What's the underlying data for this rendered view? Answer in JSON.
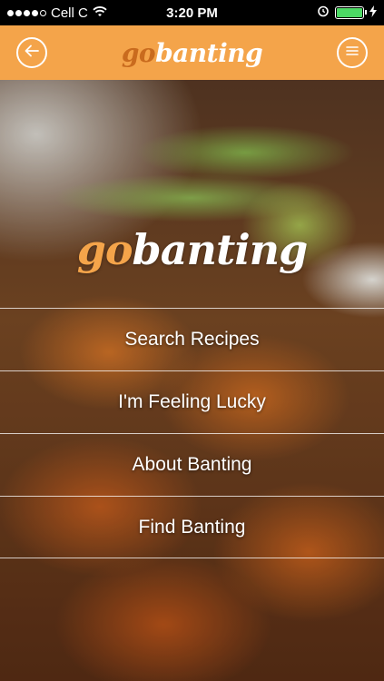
{
  "status_bar": {
    "carrier": "Cell C",
    "time": "3:20 PM",
    "signal_icon": "signal-dots-icon",
    "wifi_icon": "wifi-icon",
    "alarm_icon": "alarm-clock-icon",
    "battery_icon": "battery-icon",
    "charging_icon": "charging-bolt-icon",
    "battery_level": 1.0
  },
  "nav": {
    "back_icon": "back-arrow-icon",
    "menu_icon": "hamburger-menu-icon",
    "logo": {
      "go": "go",
      "banting": "banting"
    }
  },
  "hero": {
    "logo": {
      "go": "go",
      "banting": "banting"
    }
  },
  "menu": {
    "items": [
      {
        "label": "Search Recipes"
      },
      {
        "label": "I'm Feeling Lucky"
      },
      {
        "label": "About Banting"
      },
      {
        "label": "Find Banting"
      }
    ]
  },
  "colors": {
    "brand_orange": "#f4a44a",
    "logo_go_dark": "#c96b1e",
    "battery_green": "#4cd964"
  }
}
